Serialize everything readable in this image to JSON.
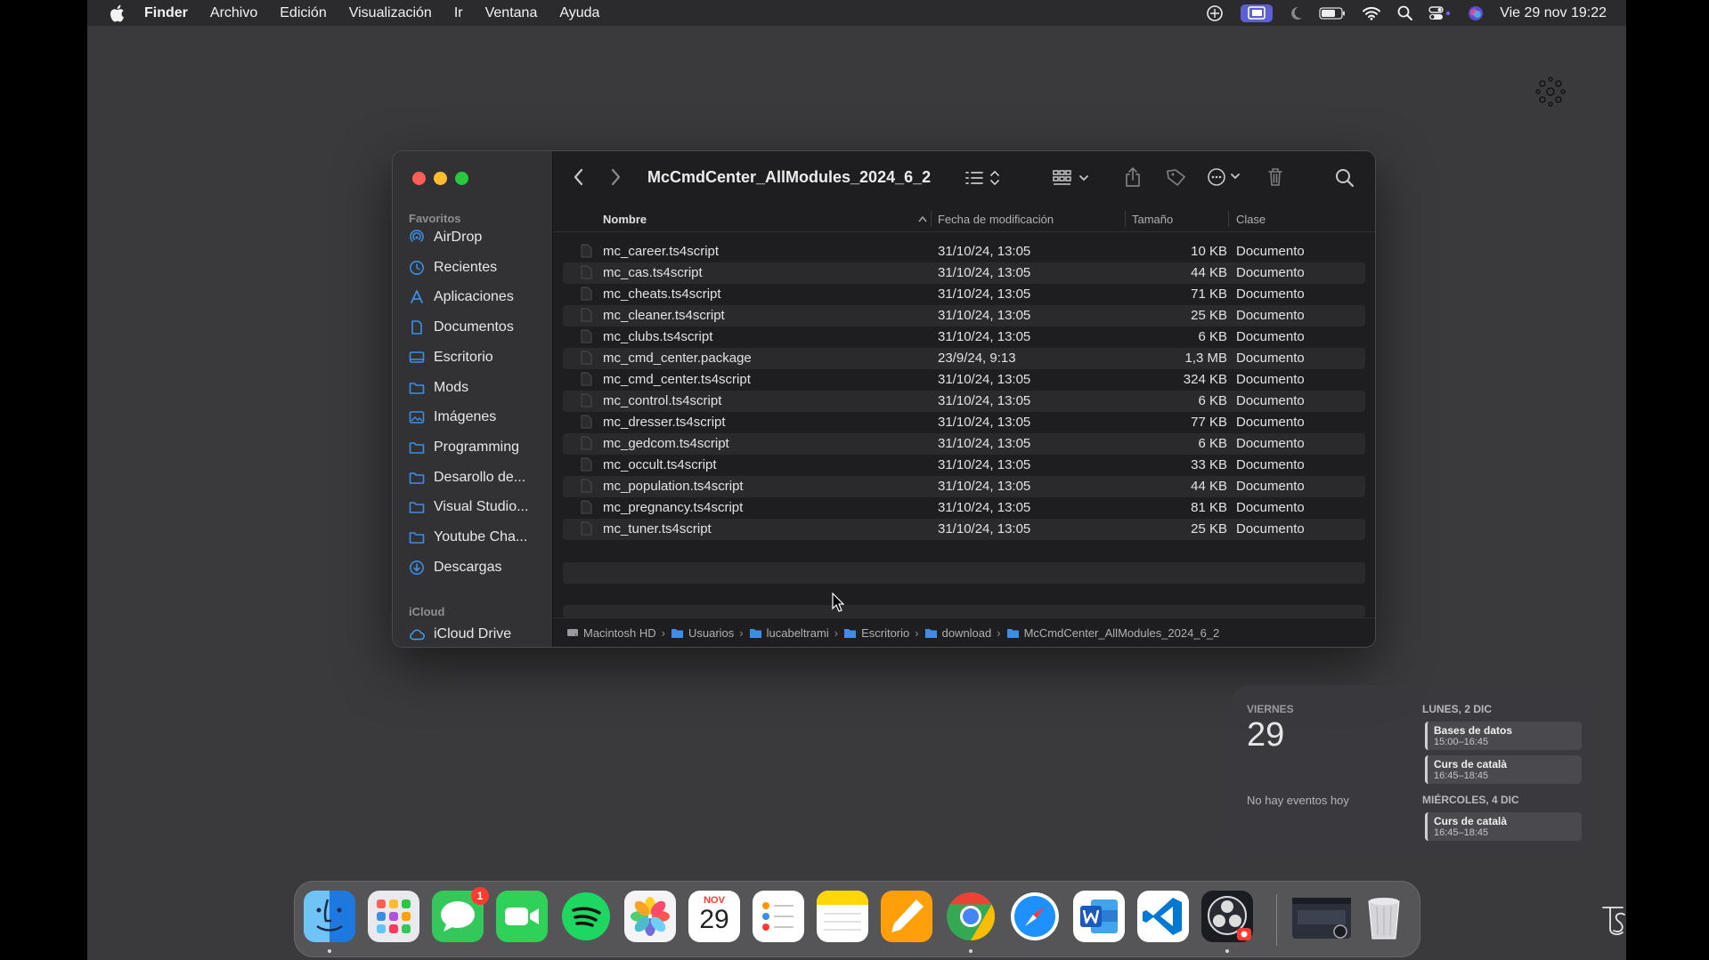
{
  "menubar": {
    "app": "Finder",
    "menus": [
      "Archivo",
      "Edición",
      "Visualización",
      "Ir",
      "Ventana",
      "Ayuda"
    ],
    "clock": "Vie 29 nov 19:22"
  },
  "finder": {
    "title": "McCmdCenter_AllModules_2024_6_2",
    "sidebar": {
      "favorites_label": "Favoritos",
      "favorites": [
        {
          "label": "AirDrop",
          "icon": "airdrop-icon"
        },
        {
          "label": "Recientes",
          "icon": "clock-icon"
        },
        {
          "label": "Aplicaciones",
          "icon": "apps-icon"
        },
        {
          "label": "Documentos",
          "icon": "document-icon"
        },
        {
          "label": "Escritorio",
          "icon": "desktop-icon"
        },
        {
          "label": "Mods",
          "icon": "folder-icon"
        },
        {
          "label": "Imágenes",
          "icon": "photo-icon"
        },
        {
          "label": "Programming",
          "icon": "folder-icon"
        },
        {
          "label": "Desarollo de...",
          "icon": "folder-icon"
        },
        {
          "label": "Visual Studio...",
          "icon": "folder-icon"
        },
        {
          "label": "Youtube Cha...",
          "icon": "folder-icon"
        },
        {
          "label": "Descargas",
          "icon": "download-icon"
        }
      ],
      "icloud_label": "iCloud",
      "icloud": [
        {
          "label": "iCloud Drive",
          "icon": "cloud-icon"
        }
      ]
    },
    "columns": {
      "name": "Nombre",
      "date": "Fecha de modificación",
      "size": "Tamaño",
      "kind": "Clase"
    },
    "files": [
      {
        "name": "mc_career.ts4script",
        "date": "31/10/24, 13:05",
        "size": "10 KB",
        "kind": "Documento"
      },
      {
        "name": "mc_cas.ts4script",
        "date": "31/10/24, 13:05",
        "size": "44 KB",
        "kind": "Documento"
      },
      {
        "name": "mc_cheats.ts4script",
        "date": "31/10/24, 13:05",
        "size": "71 KB",
        "kind": "Documento"
      },
      {
        "name": "mc_cleaner.ts4script",
        "date": "31/10/24, 13:05",
        "size": "25 KB",
        "kind": "Documento"
      },
      {
        "name": "mc_clubs.ts4script",
        "date": "31/10/24, 13:05",
        "size": "6 KB",
        "kind": "Documento"
      },
      {
        "name": "mc_cmd_center.package",
        "date": "23/9/24, 9:13",
        "size": "1,3 MB",
        "kind": "Documento"
      },
      {
        "name": "mc_cmd_center.ts4script",
        "date": "31/10/24, 13:05",
        "size": "324 KB",
        "kind": "Documento"
      },
      {
        "name": "mc_control.ts4script",
        "date": "31/10/24, 13:05",
        "size": "6 KB",
        "kind": "Documento"
      },
      {
        "name": "mc_dresser.ts4script",
        "date": "31/10/24, 13:05",
        "size": "77 KB",
        "kind": "Documento"
      },
      {
        "name": "mc_gedcom.ts4script",
        "date": "31/10/24, 13:05",
        "size": "6 KB",
        "kind": "Documento"
      },
      {
        "name": "mc_occult.ts4script",
        "date": "31/10/24, 13:05",
        "size": "33 KB",
        "kind": "Documento"
      },
      {
        "name": "mc_population.ts4script",
        "date": "31/10/24, 13:05",
        "size": "44 KB",
        "kind": "Documento"
      },
      {
        "name": "mc_pregnancy.ts4script",
        "date": "31/10/24, 13:05",
        "size": "81 KB",
        "kind": "Documento"
      },
      {
        "name": "mc_tuner.ts4script",
        "date": "31/10/24, 13:05",
        "size": "25 KB",
        "kind": "Documento"
      }
    ],
    "path": [
      "Macintosh HD",
      "Usuarios",
      "lucabeltrami",
      "Escritorio",
      "download",
      "McCmdCenter_AllModules_2024_6_2"
    ]
  },
  "calendar_widget": {
    "today_label": "VIERNES",
    "today_number": "29",
    "no_events": "No hay eventos hoy",
    "groups": [
      {
        "day": "LUNES, 2 DIC",
        "events": [
          {
            "title": "Bases de datos",
            "time": "15:00–16:45"
          },
          {
            "title": "Curs de català",
            "time": "16:45–18:45"
          }
        ]
      },
      {
        "day": "MIÉRCOLES, 4 DIC",
        "events": [
          {
            "title": "Curs de català",
            "time": "16:45–18:45"
          }
        ]
      }
    ]
  },
  "dock": {
    "apps": [
      "Finder",
      "Launchpad",
      "Mensajes",
      "FaceTime",
      "Spotify",
      "Fotos",
      "Calendario",
      "Recordatorios",
      "Notas",
      "Pages",
      "Google Chrome",
      "Safari",
      "Microsoft Word",
      "Visual Studio Code",
      "OBS",
      "Ventana minimizada",
      "Papelera"
    ],
    "messages_badge": "1",
    "calendar_month": "NOV",
    "calendar_day": "29"
  },
  "colors": {
    "close": "#ff5f57",
    "minimize": "#febc2e",
    "zoom": "#28c840",
    "folder": "#3a8ee6",
    "accent": "#5d5fd6"
  }
}
